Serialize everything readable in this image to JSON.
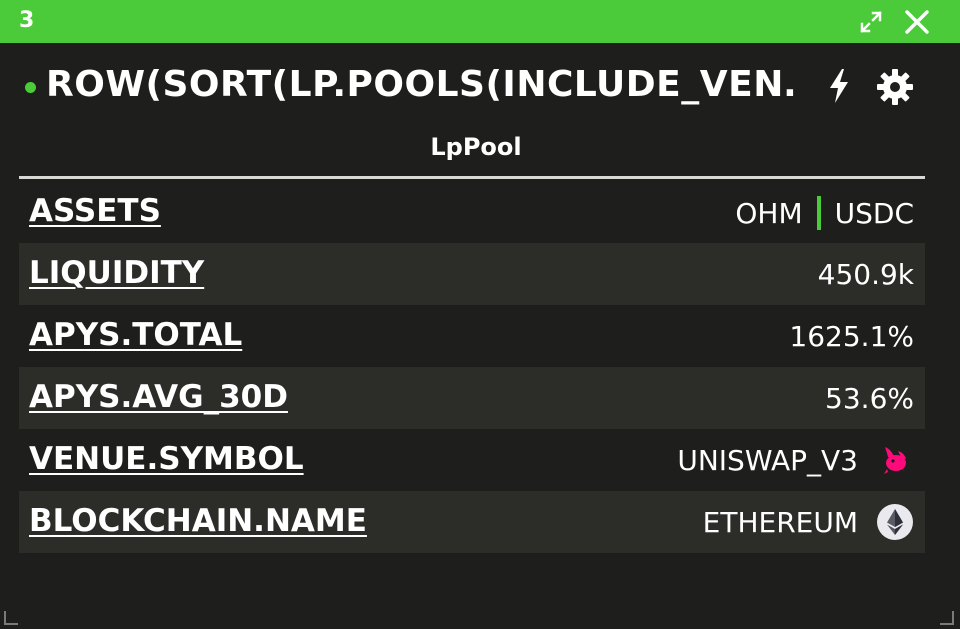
{
  "window": {
    "number": "3",
    "accent_color": "#4ccb3a"
  },
  "header": {
    "query": "ROW(SORT(LP.POOLS(INCLUDE_VEN…",
    "status": "active"
  },
  "type_label": "LpPool",
  "rows": [
    {
      "key": "ASSETS",
      "assets": [
        "OHM",
        "USDC"
      ]
    },
    {
      "key": "LIQUIDITY",
      "value": "450.9k"
    },
    {
      "key": "APYS.TOTAL",
      "value": "1625.1%"
    },
    {
      "key": "APYS.AVG_30D",
      "value": "53.6%"
    },
    {
      "key": "VENUE.SYMBOL",
      "value": "UNISWAP_V3",
      "icon": "uniswap-icon"
    },
    {
      "key": "BLOCKCHAIN.NAME",
      "value": "ETHEREUM",
      "icon": "ethereum-icon"
    }
  ]
}
